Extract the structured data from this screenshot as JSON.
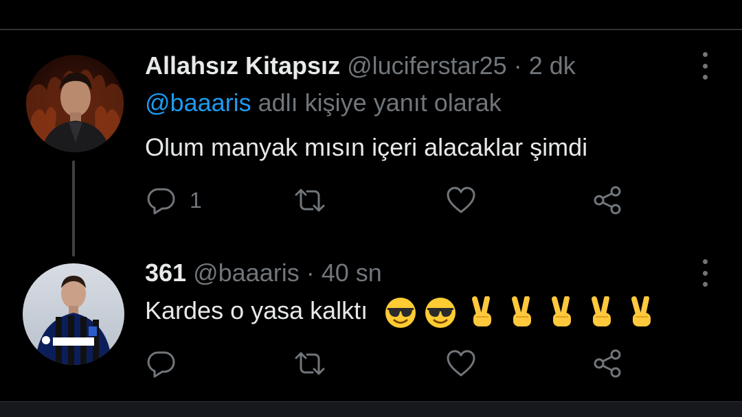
{
  "colors": {
    "background": "#000000",
    "text": "#e7e9ea",
    "muted": "#71767b",
    "link": "#1d9bf0",
    "divider": "#2f3336"
  },
  "tweets": [
    {
      "name": "Allahsız Kitapsız",
      "handle": "@luciferstar25",
      "separator": "·",
      "time": "2 dk",
      "replying_mention": "@baaaris",
      "replying_suffix": " adlı kişiye yanıt olarak",
      "text": "Olum manyak mısın içeri alacaklar şimdi",
      "reply_count": "1",
      "icons": [
        "reply-icon",
        "retweet-icon",
        "like-icon",
        "share-icon",
        "more-icon"
      ]
    },
    {
      "name": "361",
      "handle": "@baaaris",
      "separator": "·",
      "time": "40 sn",
      "text": "Kardes o yasa kalktı",
      "emojis": [
        "😎",
        "😎",
        "✌️",
        "✌️",
        "✌️",
        "✌️",
        "✌️"
      ],
      "icons": [
        "reply-icon",
        "retweet-icon",
        "like-icon",
        "share-icon",
        "more-icon"
      ]
    }
  ]
}
